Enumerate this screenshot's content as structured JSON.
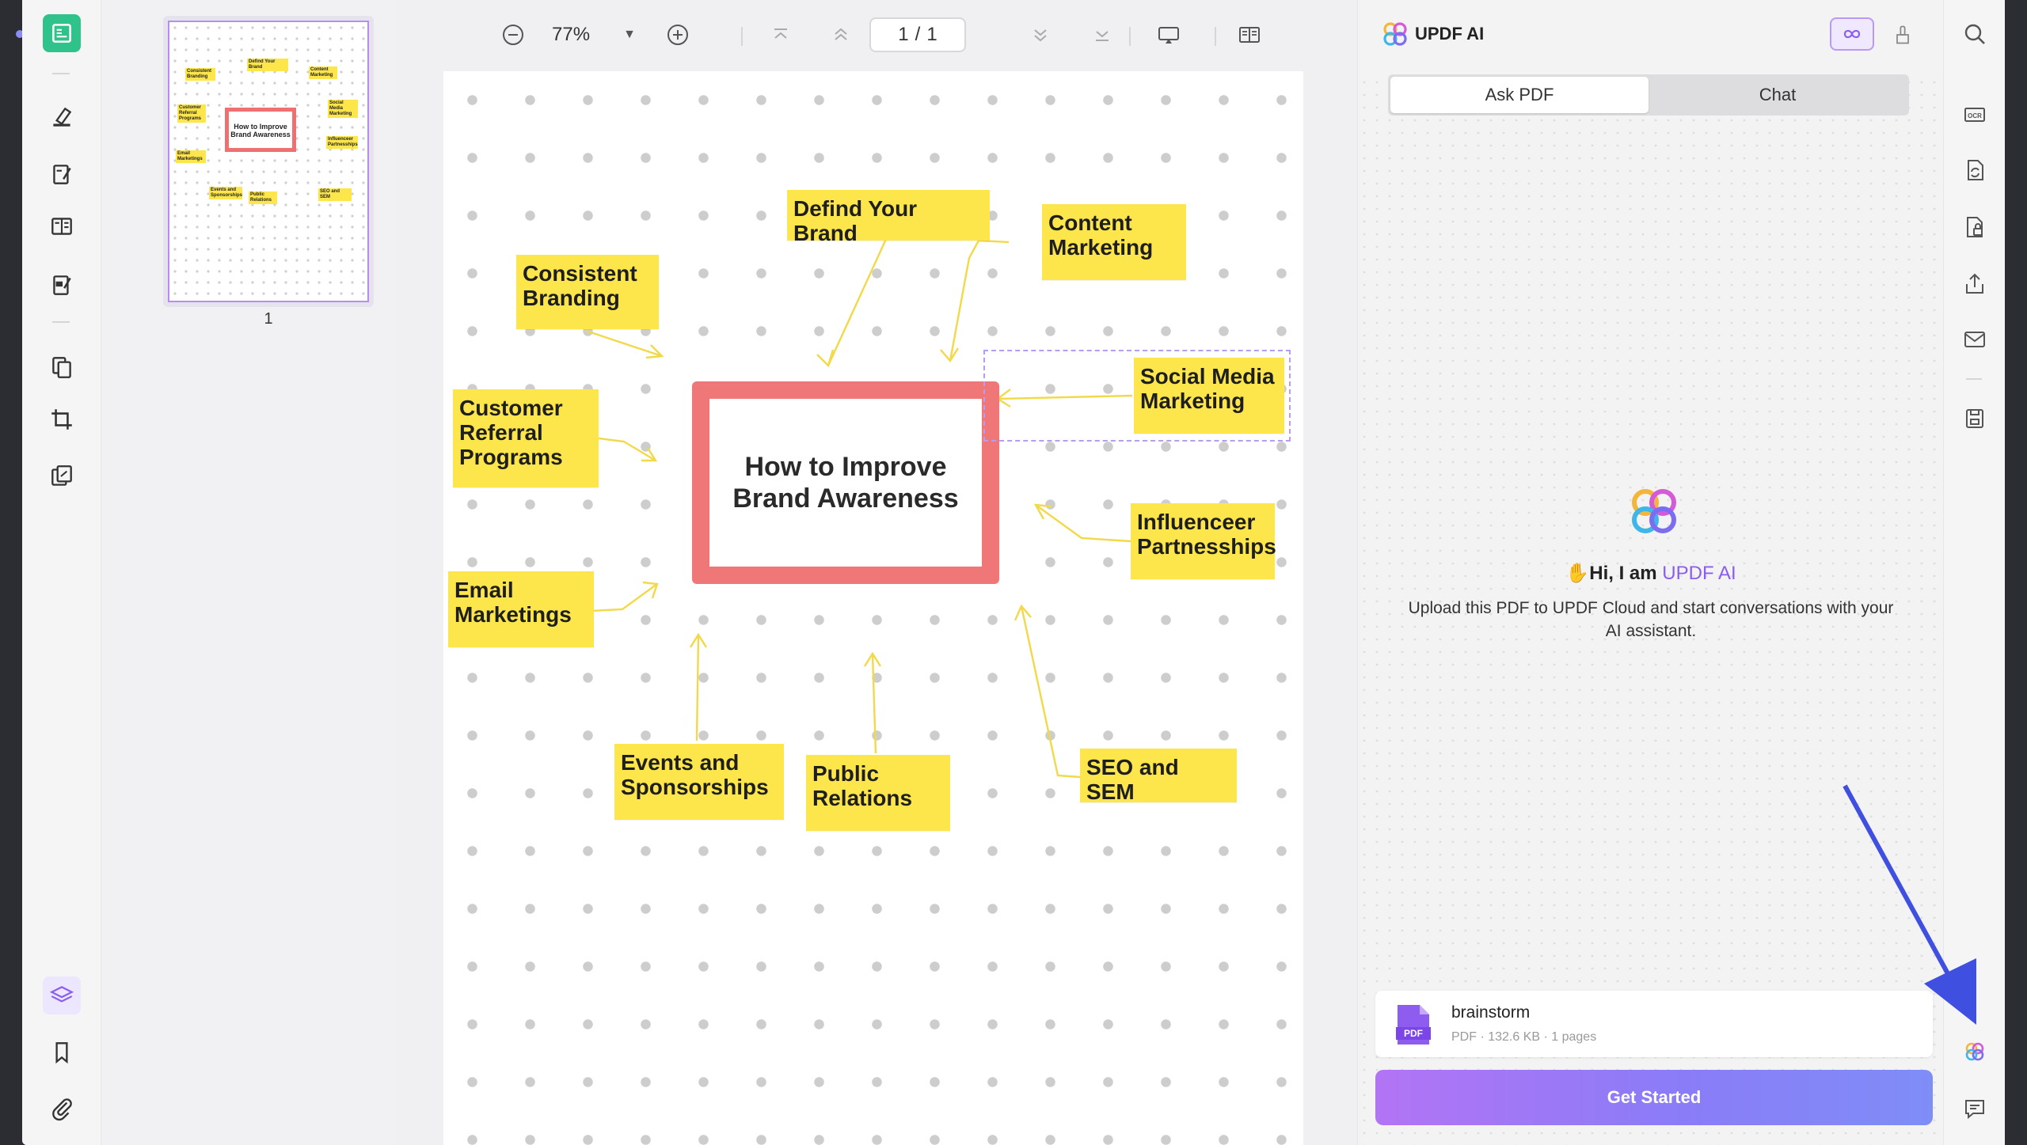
{
  "toolbar": {
    "zoom_value": "77%",
    "page_current": "1",
    "page_sep": "/",
    "page_total": "1"
  },
  "thumbnails": {
    "page_number": "1",
    "center_text": "How to Improve Brand Awareness",
    "notes": [
      "Consistent Branding",
      "Defind Your Brand",
      "Content Marketing",
      "Customer Referral Programs",
      "Social Media Marketing",
      "Influenceer Partnesships",
      "Email Marketings",
      "Events and Sponsorships",
      "Public Relations",
      "SEO and SEM"
    ]
  },
  "mindmap": {
    "center": "How to Improve Brand Awareness",
    "notes": {
      "define_brand": "Defind Your Brand",
      "content_marketing": "Content Marketing",
      "consistent_branding": "Consistent Branding",
      "customer_referral": "Customer Referral Programs",
      "social_media": "Social Media Marketing",
      "influencer": "Influenceer Partnesships",
      "email": "Email Marketings",
      "events": "Events and Sponsorships",
      "public_relations": "Public Relations",
      "seo_sem": "SEO and SEM"
    }
  },
  "ai_panel": {
    "title": "UPDF AI",
    "tabs": [
      "Ask PDF",
      "Chat"
    ],
    "active_tab": "Ask PDF",
    "greeting_prefix": "Hi, I am ",
    "greeting_brand": "UPDF AI",
    "subtitle": "Upload this PDF to UPDF Cloud and start conversations with your AI assistant.",
    "file": {
      "name": "brainstorm",
      "meta": "PDF · 132.6 KB · 1 pages",
      "icon_label": "PDF"
    },
    "cta": "Get Started"
  },
  "colors": {
    "accent_purple": "#8a5cf0",
    "note_yellow": "#fde64b",
    "box_red": "#f07777",
    "active_tool_green": "#2fc28a",
    "pointer_blue": "#3f4fe0"
  },
  "icons": {
    "left_rail": [
      "reader-icon",
      "highlighter-icon",
      "edit-pdf-icon",
      "organize-icon",
      "form-icon",
      "convert-icon",
      "crop-icon",
      "compress-icon",
      "layers-icon",
      "bookmark-icon",
      "attachment-icon"
    ],
    "right_rail": [
      "search-icon",
      "ocr-icon",
      "convert-icon",
      "protect-icon",
      "share-icon",
      "email-icon",
      "save-icon",
      "updf-ai-icon",
      "comment-icon"
    ]
  }
}
